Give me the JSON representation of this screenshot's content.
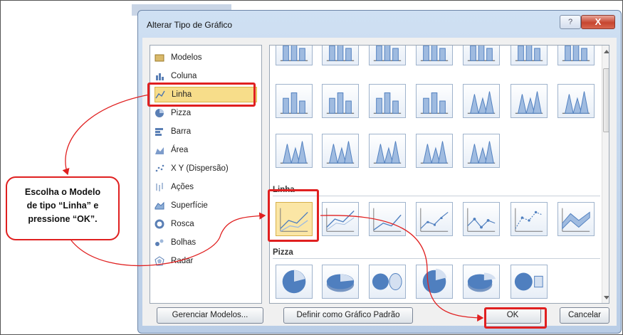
{
  "dialog": {
    "title": "Alterar Tipo de Gráfico",
    "help_label": "?",
    "close_label": "X"
  },
  "categories": [
    {
      "label": "Modelos",
      "icon": "folder-icon"
    },
    {
      "label": "Coluna",
      "icon": "column-chart-icon"
    },
    {
      "label": "Linha",
      "icon": "line-chart-icon",
      "selected": true
    },
    {
      "label": "Pizza",
      "icon": "pie-chart-icon"
    },
    {
      "label": "Barra",
      "icon": "bar-chart-icon"
    },
    {
      "label": "Área",
      "icon": "area-chart-icon"
    },
    {
      "label": "X Y (Dispersão)",
      "icon": "scatter-chart-icon"
    },
    {
      "label": "Ações",
      "icon": "stock-chart-icon"
    },
    {
      "label": "Superfície",
      "icon": "surface-chart-icon"
    },
    {
      "label": "Rosca",
      "icon": "doughnut-chart-icon"
    },
    {
      "label": "Bolhas",
      "icon": "bubble-chart-icon"
    },
    {
      "label": "Radar",
      "icon": "radar-chart-icon"
    }
  ],
  "sections": {
    "linha": "Linha",
    "pizza": "Pizza"
  },
  "buttons": {
    "manage": "Gerenciar Modelos...",
    "set_default": "Definir como Gráfico Padrão",
    "ok": "OK",
    "cancel": "Cancelar"
  },
  "callout": {
    "line1": "Escolha o Modelo",
    "line2": "de tipo “Linha” e",
    "line3": "pressione “OK”."
  },
  "colors": {
    "accent_red": "#e02020",
    "selection": "#f7dd8a",
    "chart_blue": "#4f7fbf"
  }
}
